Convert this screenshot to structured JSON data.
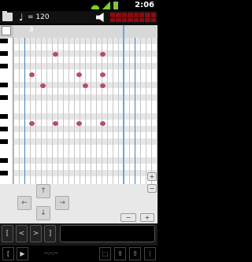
{
  "status_bar": {
    "clock": "2:06"
  },
  "toolbar": {
    "tempo_label": "= 120",
    "note_symbol": "♩"
  },
  "ruler": {
    "measure_label": "3"
  },
  "colors": {
    "note": "#b54b70",
    "note_selected": "#3d61d8",
    "playhead": "#6aa4e0",
    "meter": "#8a0c10"
  },
  "nav": {
    "up_label": "↑",
    "down_label": "↓",
    "left_label": "←",
    "right_label": "→",
    "zoom_in_label": "+",
    "zoom_out_label": "−",
    "v_plus_label": "+",
    "v_minus_label": "−"
  },
  "transport": {
    "bracket_left": "[",
    "prev_label": "<",
    "next_label": ">",
    "bracket_right": "]"
  },
  "footer": {
    "bracket_label": "[",
    "play_label": "▶",
    "time_label": "--:-:--",
    "loop_label": "⬚",
    "export_label": "⇪",
    "share_label": "⇧",
    "menu_label": "⋮"
  }
}
